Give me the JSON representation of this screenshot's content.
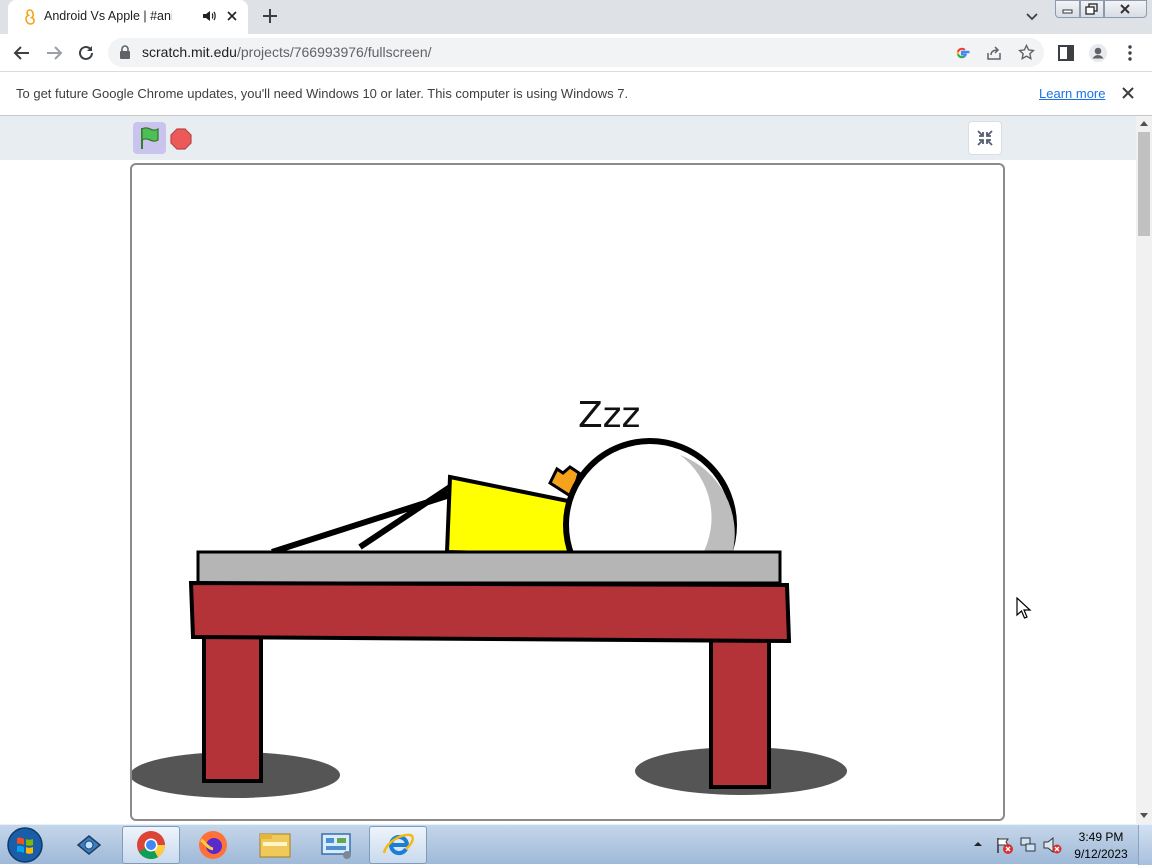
{
  "browser": {
    "tab": {
      "title": "Android Vs Apple | #animati"
    },
    "url": {
      "host": "scratch.mit.edu",
      "path": "/projects/766993976/fullscreen/"
    }
  },
  "infobar": {
    "message": "To get future Google Chrome updates, you'll need Windows 10 or later. This computer is using Windows 7.",
    "link": "Learn more"
  },
  "stage": {
    "caption": "Zzz"
  },
  "taskbar": {
    "apps": [
      "chrome",
      "firefox",
      "file-explorer",
      "control-panel",
      "internet-explorer"
    ],
    "clock_time": "3:49 PM",
    "clock_date": "9/12/2023"
  },
  "colors": {
    "accent": "#1a73e8",
    "table_red": "#b33338",
    "tabletop_gray": "#b5b5b5",
    "body_yellow": "#ffff00",
    "shadow": "#555555",
    "crown_orange": "#f7a21b"
  }
}
